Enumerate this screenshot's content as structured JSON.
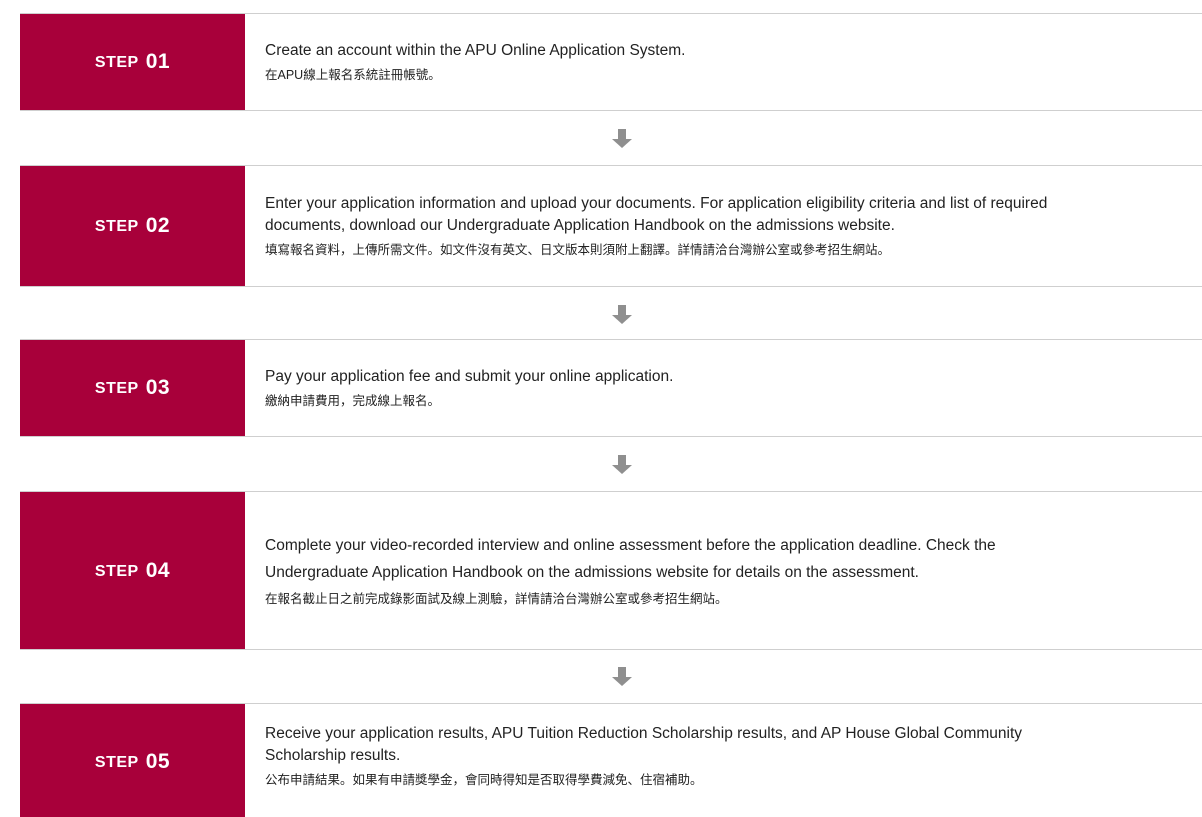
{
  "steps": [
    {
      "word": "STEP",
      "number": "01",
      "en_lines": [
        "Create an account within the APU Online Application System."
      ],
      "zh": "在APU線上報名系統註冊帳號。"
    },
    {
      "word": "STEP",
      "number": "02",
      "en_lines": [
        "Enter your application information and upload your documents. For application eligibility criteria and list of required",
        "documents, download our Undergraduate Application Handbook on the admissions website."
      ],
      "zh": "填寫報名資料，上傳所需文件。如文件沒有英文、日文版本則須附上翻譯。詳情請洽台灣辦公室或參考招生網站。"
    },
    {
      "word": "STEP",
      "number": "03",
      "en_lines": [
        "Pay your application fee and submit your online application."
      ],
      "zh": "繳納申請費用，完成線上報名。"
    },
    {
      "word": "STEP",
      "number": "04",
      "en_lines": [
        "Complete your video-recorded interview and online assessment before the application deadline. Check the",
        "Undergraduate Application Handbook on the admissions website for details on the assessment."
      ],
      "zh": "在報名截止日之前完成錄影面試及線上測驗，詳情請洽台灣辦公室或參考招生網站。"
    },
    {
      "word": "STEP",
      "number": "05",
      "en_lines": [
        "Receive your application results, APU Tuition Reduction Scholarship results, and AP House Global Community",
        "Scholarship results."
      ],
      "zh": "公布申請結果。如果有申請獎學金，會同時得知是否取得學費減免、住宿補助。"
    }
  ],
  "arrows": [
    {
      "icon": "down-arrow-icon"
    },
    {
      "icon": "down-arrow-icon"
    },
    {
      "icon": "down-arrow-icon"
    },
    {
      "icon": "down-arrow-icon"
    }
  ],
  "colors": {
    "step_label_bg": "#a8003a",
    "step_label_text": "#ffffff",
    "arrow": "#8f8f8f",
    "divider": "#cfcfcf"
  }
}
